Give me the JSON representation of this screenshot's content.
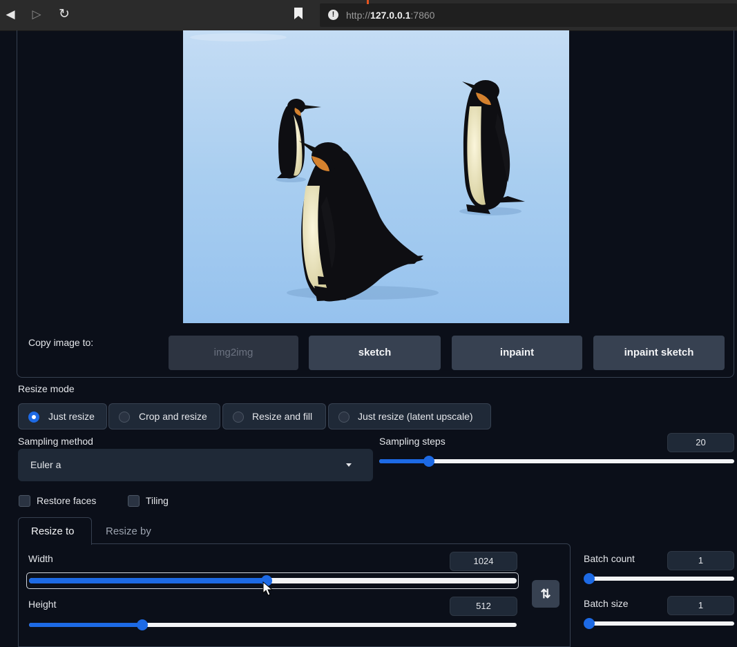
{
  "browser": {
    "url_prefix": "http://",
    "url_host": "127.0.0.1",
    "url_port": ":7860"
  },
  "image_section": {
    "copy_label": "Copy image to:",
    "buttons": [
      {
        "label": "img2img",
        "disabled": true
      },
      {
        "label": "sketch",
        "disabled": false
      },
      {
        "label": "inpaint",
        "disabled": false
      },
      {
        "label": "inpaint sketch",
        "disabled": false
      }
    ]
  },
  "resize_mode": {
    "label": "Resize mode",
    "options": [
      "Just resize",
      "Crop and resize",
      "Resize and fill",
      "Just resize (latent upscale)"
    ],
    "selected": "Just resize"
  },
  "sampling_method": {
    "label": "Sampling method",
    "value": "Euler a"
  },
  "sampling_steps": {
    "label": "Sampling steps",
    "value": "20"
  },
  "checkboxes": {
    "restore_faces": "Restore faces",
    "tiling": "Tiling"
  },
  "tabs": [
    "Resize to",
    "Resize by"
  ],
  "width": {
    "label": "Width",
    "value": "1024"
  },
  "height": {
    "label": "Height",
    "value": "512"
  },
  "batch_count": {
    "label": "Batch count",
    "value": "1"
  },
  "batch_size": {
    "label": "Batch size",
    "value": "1"
  },
  "swap_icon": "⇅",
  "colors": {
    "background": "#0b0f19",
    "accent": "#1d6ae5",
    "button": "#374151"
  },
  "icons": [
    "back-icon",
    "forward-icon",
    "reload-icon",
    "bookmark-icon",
    "info-icon",
    "dropdown-caret-icon",
    "swap-icon",
    "mouse-cursor-icon"
  ]
}
